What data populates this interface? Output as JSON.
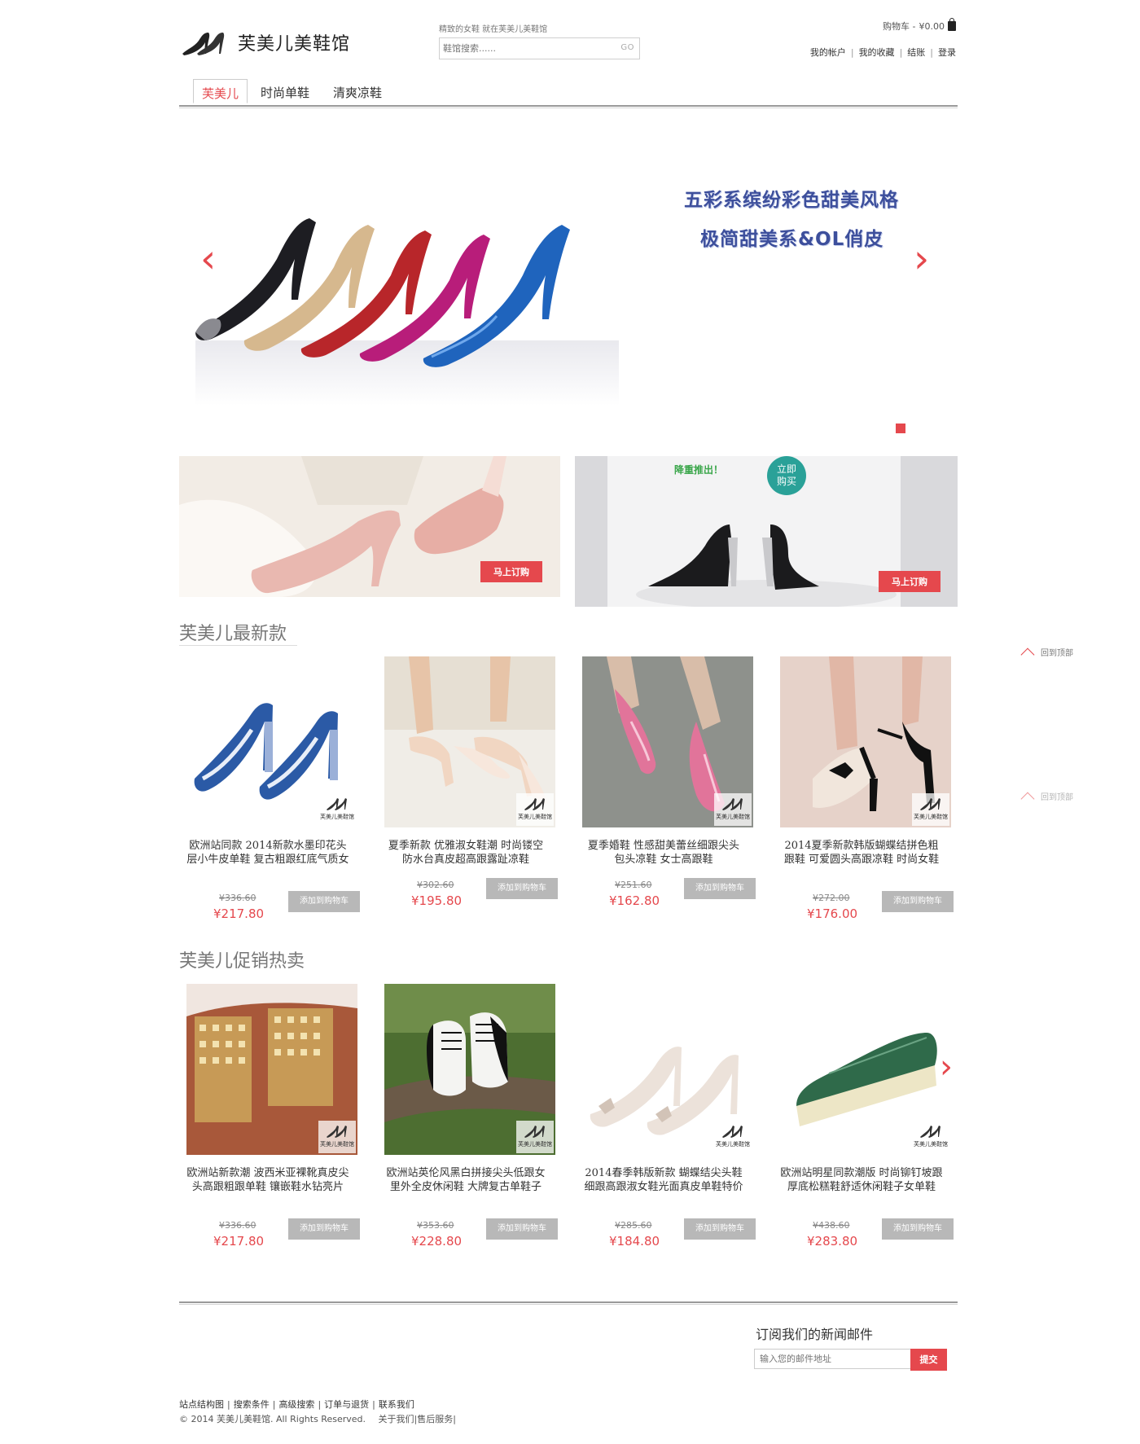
{
  "header": {
    "logo_text": "芙美儿美鞋馆",
    "tagline": "精致的女鞋 就在芙美儿美鞋馆",
    "search_placeholder": "鞋馆搜索......",
    "search_button": "GO",
    "cart_label": "购物车 -",
    "cart_total": "¥0.00",
    "account_links": [
      "我的帐户",
      "我的收藏",
      "结账",
      "登录"
    ]
  },
  "nav": {
    "tabs": [
      "芙美儿",
      "时尚单鞋",
      "清爽凉鞋"
    ],
    "active_index": 0
  },
  "banner": {
    "line1": "五彩系缤纷彩色甜美风格",
    "line2": "极简甜美系&OL俏皮",
    "prev_arrow": "‹",
    "next_arrow": "›",
    "slide_count": 1
  },
  "promos": [
    {
      "button": "马上订购"
    },
    {
      "tag": "降重推出！",
      "badge_line1": "立即",
      "badge_line2": "购买",
      "button": "马上订购"
    }
  ],
  "watermark_text": "芙美儿美鞋馆",
  "back_to_top": "回到顶部",
  "sections": [
    {
      "title": "芙美儿最新款",
      "products": [
        {
          "name": "欧洲站同款 2014新款水墨印花头层小牛皮单鞋 复古粗跟红底气质女",
          "old_price": "¥336.60",
          "price": "¥217.80",
          "add_button": "添加到购物车"
        },
        {
          "name": "夏季新款 优雅淑女鞋潮 时尚镂空防水台真皮超高跟露趾凉鞋",
          "old_price": "¥302.60",
          "price": "¥195.80",
          "add_button": "添加到购物车"
        },
        {
          "name": "夏季婚鞋 性感甜美蕾丝细跟尖头 包头凉鞋 女士高跟鞋",
          "old_price": "¥251.60",
          "price": "¥162.80",
          "add_button": "添加到购物车"
        },
        {
          "name": "2014夏季新款韩版蝴蝶结拼色粗跟鞋 可爱圆头高跟凉鞋 时尚女鞋",
          "old_price": "¥272.00",
          "price": "¥176.00",
          "add_button": "添加到购物车"
        }
      ]
    },
    {
      "title": "芙美儿促销热卖",
      "products": [
        {
          "name": "欧洲站新款潮 波西米亚裸靴真皮尖头高跟粗跟单鞋 镶嵌鞋水钻亮片",
          "old_price": "¥336.60",
          "price": "¥217.80",
          "add_button": "添加到购物车"
        },
        {
          "name": "欧洲站英伦风黑白拼接尖头低跟女 里外全皮休闲鞋 大牌复古单鞋子",
          "old_price": "¥353.60",
          "price": "¥228.80",
          "add_button": "添加到购物车"
        },
        {
          "name": "2014春季韩版新款 蝴蝶结尖头鞋 细跟高跟淑女鞋光面真皮单鞋特价",
          "old_price": "¥285.60",
          "price": "¥184.80",
          "add_button": "添加到购物车"
        },
        {
          "name": "欧洲站明星同款潮版 时尚铆钉坡跟厚底松糕鞋舒适休闲鞋子女单鞋",
          "old_price": "¥438.60",
          "price": "¥283.80",
          "add_button": "添加到购物车"
        }
      ]
    }
  ],
  "footer": {
    "newsletter_title": "订阅我们的新闻邮件",
    "newsletter_placeholder": "输入您的邮件地址",
    "newsletter_button": "提交",
    "links": [
      "站点结构图",
      "搜索条件",
      "高级搜索",
      "订单与退货",
      "联系我们"
    ],
    "copyright": "© 2014 芙美儿美鞋馆. All Rights Reserved.",
    "links2": [
      "关于我们",
      "售后服务"
    ]
  },
  "colors": {
    "accent": "#e5484d",
    "banner_text": "#3d4f9c",
    "button_gray": "#b8b8b8"
  }
}
